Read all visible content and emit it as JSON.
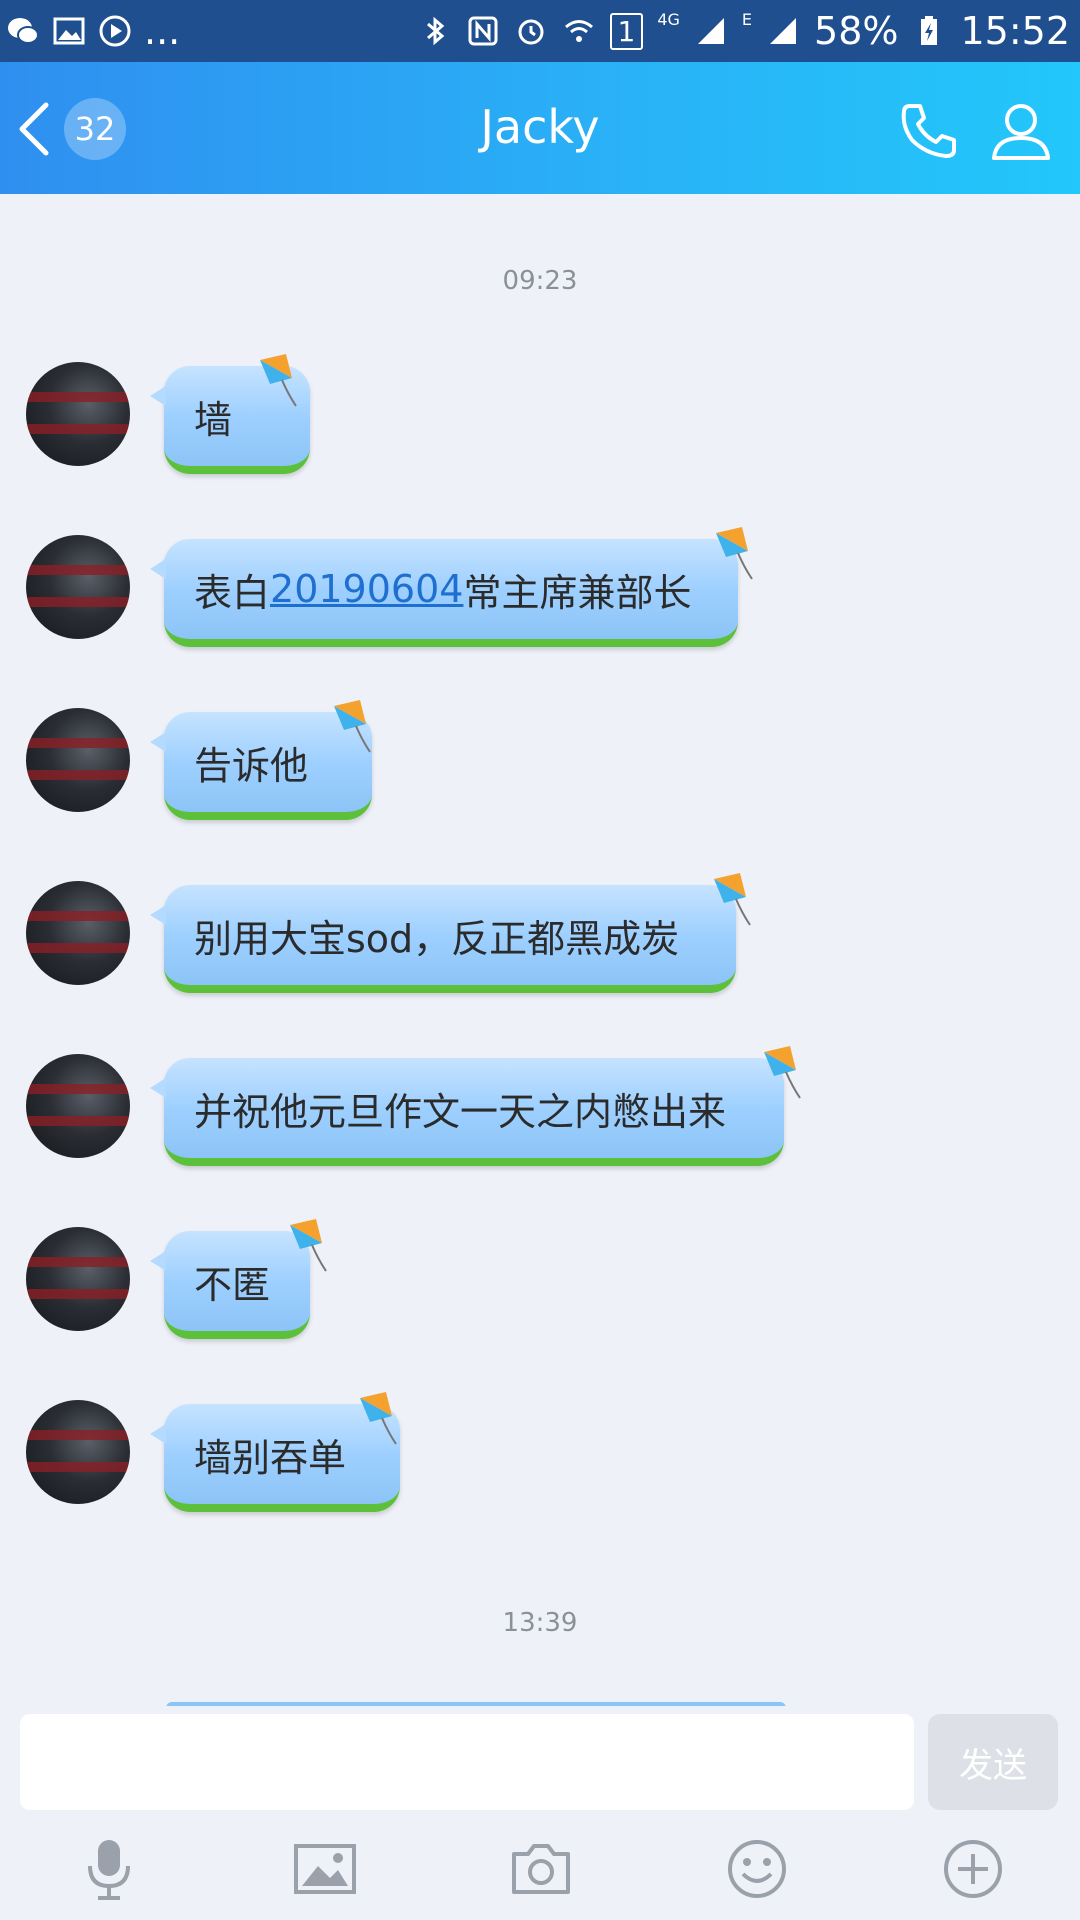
{
  "status_bar": {
    "left_icons": [
      "wechat-icon",
      "gallery-icon",
      "play-icon"
    ],
    "overflow": "...",
    "battery": "58%",
    "time": "15:52",
    "network": "4G",
    "network2": "E",
    "sim": "1"
  },
  "header": {
    "unread_count": "32",
    "contact_name": "Jacky",
    "icons": [
      "back-icon",
      "phone-icon",
      "contact-icon"
    ]
  },
  "chat": {
    "timestamps": [
      "09:23",
      "13:39"
    ],
    "messages": [
      {
        "text": "墙"
      },
      {
        "prefix": "表白",
        "link": "20190604",
        "suffix": "常主席兼部长"
      },
      {
        "text": "告诉他"
      },
      {
        "text": "别用大宝sod，反正都黑成炭"
      },
      {
        "text": "并祝他元旦作文一天之内憋出来"
      },
      {
        "text": "不匿"
      },
      {
        "text": "墙别吞单"
      }
    ]
  },
  "input": {
    "value": "",
    "send_label": "发送"
  },
  "toolbar": {
    "icons": [
      "microphone-icon",
      "image-icon",
      "camera-icon",
      "emoji-icon",
      "plus-icon"
    ]
  },
  "colors": {
    "header_start": "#2f8ff0",
    "header_end": "#22c7fb",
    "bubble": "#9ed0ff",
    "bubble_border": "#5cc03a",
    "background": "#eef1f8"
  }
}
